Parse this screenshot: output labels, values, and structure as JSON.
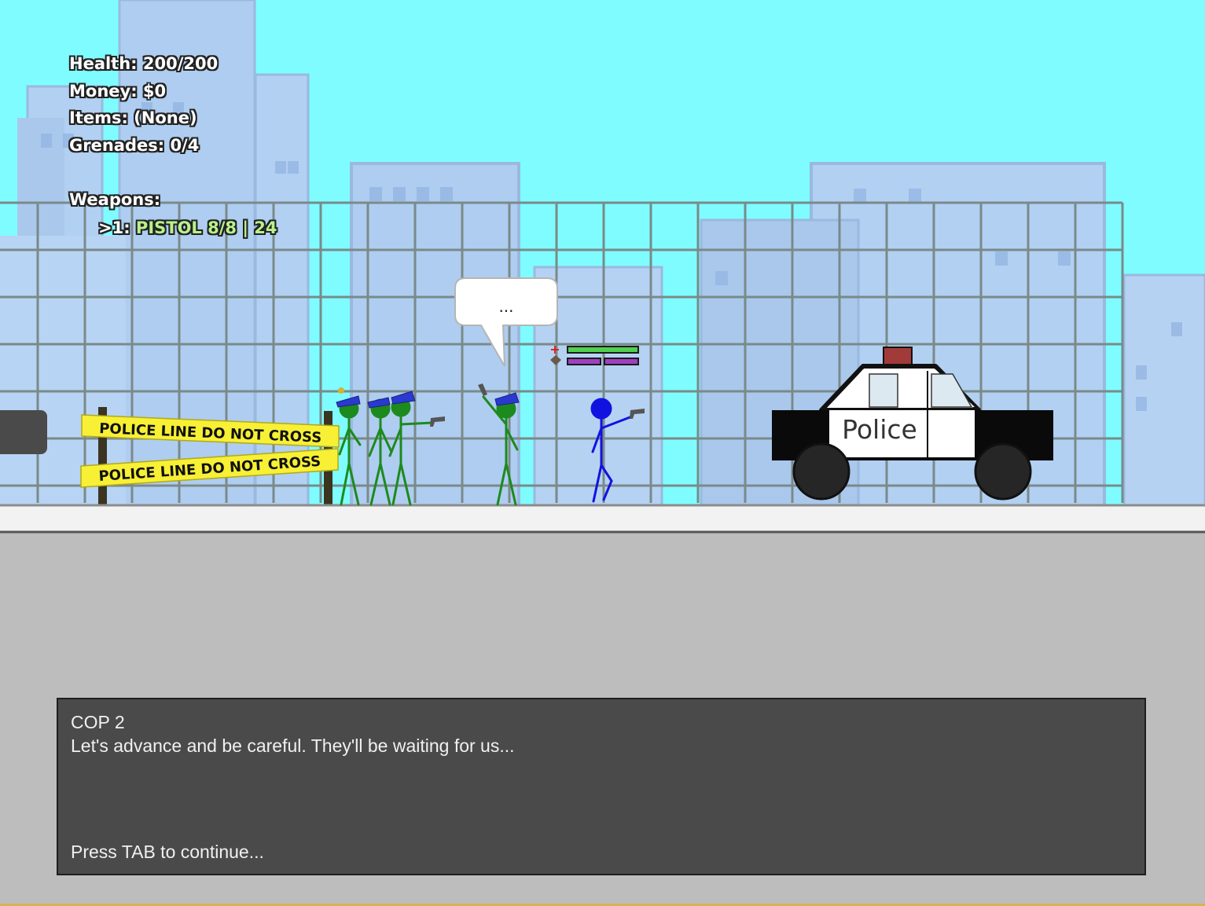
{
  "hud": {
    "health": "Health: 200/200",
    "money": "Money: $0",
    "items": "Items: (None)",
    "grenades": "Grenades: 0/4",
    "weapons_header": "Weapons:",
    "weapon_prefix": ">1: ",
    "weapon_name": "PISTOL 8/8 | 24"
  },
  "scene": {
    "speech_bubble": "...",
    "tape_top": "POLICE LINE DO NOT CROSS",
    "tape_bottom": "POLICE LINE DO NOT CROSS",
    "car_label": "Police",
    "player_health_fraction": 1.0,
    "colors": {
      "sky": "#7ffcff",
      "player": "#1212e0",
      "cops": "#1d8a1d",
      "tape": "#f7f035",
      "ground": "#bdbdbd"
    }
  },
  "dialog": {
    "speaker": "COP 2",
    "line": "Let's advance and be careful. They'll be waiting for us...",
    "prompt": "Press TAB to continue..."
  }
}
